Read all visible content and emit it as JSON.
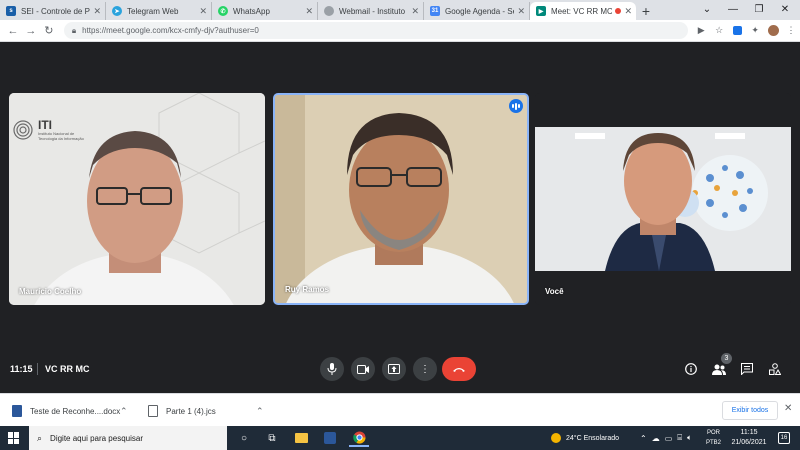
{
  "browser": {
    "tabs": [
      {
        "title": "SEI - Controle de Proc",
        "icon": "sei-favicon",
        "color": "#1a5fa8",
        "active": false
      },
      {
        "title": "Telegram Web",
        "icon": "telegram-favicon",
        "color": "#2aa3dd",
        "active": false
      },
      {
        "title": "WhatsApp",
        "icon": "whatsapp-favicon",
        "color": "#25d366",
        "active": false
      },
      {
        "title": "Webmail - Instituto Na",
        "icon": "webmail-favicon",
        "color": "#9aa0a6",
        "active": false
      },
      {
        "title": "Google Agenda - Sem",
        "icon": "calendar-favicon",
        "color": "#4285f4",
        "active": false
      },
      {
        "title": "Meet: VC RR MC",
        "icon": "meet-favicon",
        "color": "#00897b",
        "active": true
      }
    ],
    "url": "https://meet.google.com/kcx-cmfy-djv?authuser=0"
  },
  "meet": {
    "participants": [
      {
        "name": "Maurício Coelho",
        "background": "#e4e4e2"
      },
      {
        "name": "Ruy Ramos",
        "background": "#d8cdb8",
        "speaking": true
      },
      {
        "name": "Você",
        "background": "#202124"
      }
    ],
    "logo": {
      "brand": "ITI",
      "subtitle": "Instituto Nacional de Tecnologia da Informação"
    },
    "time": "11:15",
    "meeting_name": "VC RR MC",
    "participant_count": "3",
    "colors": {
      "hangup": "#ea4335",
      "control": "#3c4043",
      "speaking": "#1a73e8"
    }
  },
  "downloads": {
    "items": [
      {
        "name": "Teste de Reconhe....docx"
      },
      {
        "name": "Parte 1 (4).jcs"
      }
    ],
    "show_all": "Exibir todos"
  },
  "taskbar": {
    "search_placeholder": "Digite aqui para pesquisar",
    "weather": "24°C  Ensolarado",
    "lang_top": "POR",
    "lang_bottom": "PTB2",
    "time": "11:15",
    "date": "21/06/2021",
    "notifications": "16"
  }
}
